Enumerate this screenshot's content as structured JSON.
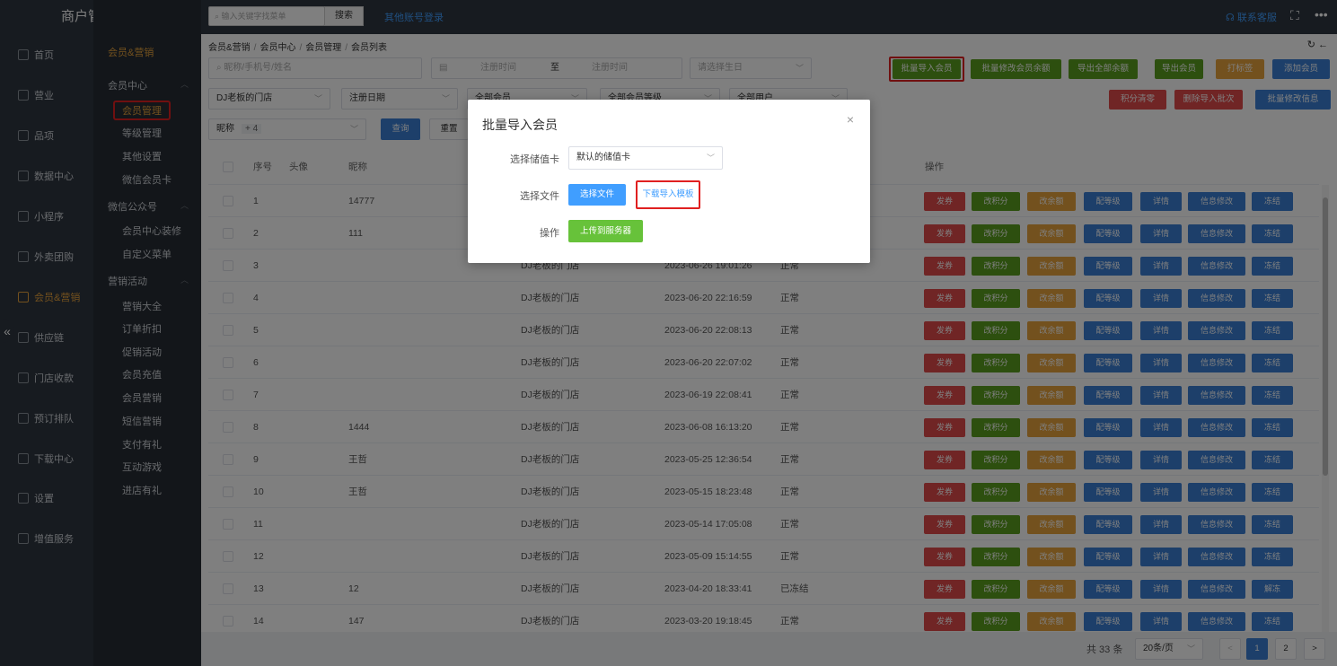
{
  "app": {
    "title": "商户管理平台"
  },
  "topbar": {
    "search_placeholder": "输入关键字找菜单",
    "search_btn": "搜索",
    "other_login": "其他账号登录",
    "service": "联系客服",
    "more": "•••"
  },
  "sidebar": {
    "items": [
      {
        "label": "首页",
        "icon": "home-icon"
      },
      {
        "label": "营业",
        "icon": "calendar-icon"
      },
      {
        "label": "品项",
        "icon": "bag-icon"
      },
      {
        "label": "数据中心",
        "icon": "share-icon"
      },
      {
        "label": "小程序",
        "icon": "phone-icon"
      },
      {
        "label": "外卖团购",
        "icon": "link-icon"
      },
      {
        "label": "会员&营销",
        "icon": "user-icon"
      },
      {
        "label": "供应链",
        "icon": "truck-icon"
      },
      {
        "label": "门店收款",
        "icon": "wallet-icon"
      },
      {
        "label": "预订排队",
        "icon": "clock-icon"
      },
      {
        "label": "下载中心",
        "icon": "download-icon"
      },
      {
        "label": "设置",
        "icon": "gear-icon"
      },
      {
        "label": "增值服务",
        "icon": "gift-icon"
      }
    ]
  },
  "subnav": {
    "header": "会员&营销",
    "groups": [
      {
        "label": "会员中心",
        "items": [
          "会员管理",
          "等级管理",
          "其他设置",
          "微信会员卡"
        ]
      },
      {
        "label": "微信公众号",
        "items": [
          "会员中心装修",
          "自定义菜单"
        ]
      },
      {
        "label": "营销活动",
        "items": [
          "营销大全",
          "订单折扣",
          "促销活动",
          "会员充值",
          "会员营销",
          "短信营销",
          "支付有礼",
          "互动游戏",
          "进店有礼"
        ]
      }
    ]
  },
  "breadcrumb": [
    "会员&营销",
    "会员中心",
    "会员管理",
    "会员列表"
  ],
  "filters": {
    "keyword_placeholder": "昵称/手机号/姓名",
    "date_start": "注册时间",
    "date_to": "至",
    "date_end": "注册时间",
    "birthday_placeholder": "请选择生日",
    "store": "DJ老板的门店",
    "date_type": "注册日期",
    "member_type": "全部会员",
    "member_level": "全部会员等级",
    "user_type": "全部用户",
    "sort_field": "昵称",
    "sort_plus": "+ 4",
    "query": "查询",
    "reset": "重置"
  },
  "toolbar": {
    "batch_import": "批量导入会员",
    "batch_balance": "批量修改会员余额",
    "export_balance": "导出全部余额",
    "export_members": "导出会员",
    "tag": "打标签",
    "add_member": "添加会员",
    "clear_points": "积分清零",
    "delete_batch": "删除导入批次",
    "batch_info": "批量修改信息"
  },
  "table": {
    "headers": [
      "序号",
      "头像",
      "昵称",
      "操作"
    ],
    "actions": [
      "发券",
      "改积分",
      "改余额",
      "配等级",
      "详情",
      "信息修改",
      "冻结"
    ],
    "rows": [
      {
        "no": "1",
        "nick": "14777",
        "store": "",
        "time": "",
        "status": "",
        "last": "冻结"
      },
      {
        "no": "2",
        "nick": "111",
        "store": "",
        "time": "",
        "status": "",
        "last": "冻结"
      },
      {
        "no": "3",
        "nick": "",
        "store": "DJ老板的门店",
        "time": "2023-06-26 19:01:26",
        "status": "正常",
        "last": "冻结"
      },
      {
        "no": "4",
        "nick": "",
        "store": "DJ老板的门店",
        "time": "2023-06-20 22:16:59",
        "status": "正常",
        "last": "冻结"
      },
      {
        "no": "5",
        "nick": "",
        "store": "DJ老板的门店",
        "time": "2023-06-20 22:08:13",
        "status": "正常",
        "last": "冻结"
      },
      {
        "no": "6",
        "nick": "",
        "store": "DJ老板的门店",
        "time": "2023-06-20 22:07:02",
        "status": "正常",
        "last": "冻结"
      },
      {
        "no": "7",
        "nick": "",
        "store": "DJ老板的门店",
        "time": "2023-06-19 22:08:41",
        "status": "正常",
        "last": "冻结"
      },
      {
        "no": "8",
        "nick": "1444",
        "store": "DJ老板的门店",
        "time": "2023-06-08 16:13:20",
        "status": "正常",
        "last": "冻结"
      },
      {
        "no": "9",
        "nick": "王哲",
        "store": "DJ老板的门店",
        "time": "2023-05-25 12:36:54",
        "status": "正常",
        "last": "冻结"
      },
      {
        "no": "10",
        "nick": "王哲",
        "store": "DJ老板的门店",
        "time": "2023-05-15 18:23:48",
        "status": "正常",
        "last": "冻结"
      },
      {
        "no": "11",
        "nick": "",
        "store": "DJ老板的门店",
        "time": "2023-05-14 17:05:08",
        "status": "正常",
        "last": "冻结"
      },
      {
        "no": "12",
        "nick": "",
        "store": "DJ老板的门店",
        "time": "2023-05-09 15:14:55",
        "status": "正常",
        "last": "冻结"
      },
      {
        "no": "13",
        "nick": "12",
        "store": "DJ老板的门店",
        "time": "2023-04-20 18:33:41",
        "status": "已冻结",
        "last": "解冻"
      },
      {
        "no": "14",
        "nick": "147",
        "store": "DJ老板的门店",
        "time": "2023-03-20 19:18:45",
        "status": "正常",
        "last": "冻结"
      }
    ]
  },
  "pager": {
    "total": "共 33 条",
    "page_size": "20条/页",
    "pages": [
      "1",
      "2"
    ],
    "prev": "<",
    "next": ">"
  },
  "modal": {
    "title": "批量导入会员",
    "card_label": "选择储值卡",
    "card_value": "默认的储值卡",
    "file_label": "选择文件",
    "choose_file": "选择文件",
    "download_template": "下载导入模板",
    "op_label": "操作",
    "upload": "上传到服务器",
    "close": "×"
  },
  "colors": {
    "accent": "#e6a23c",
    "sidebar": "#2f3640",
    "highlight": "#e02020"
  }
}
